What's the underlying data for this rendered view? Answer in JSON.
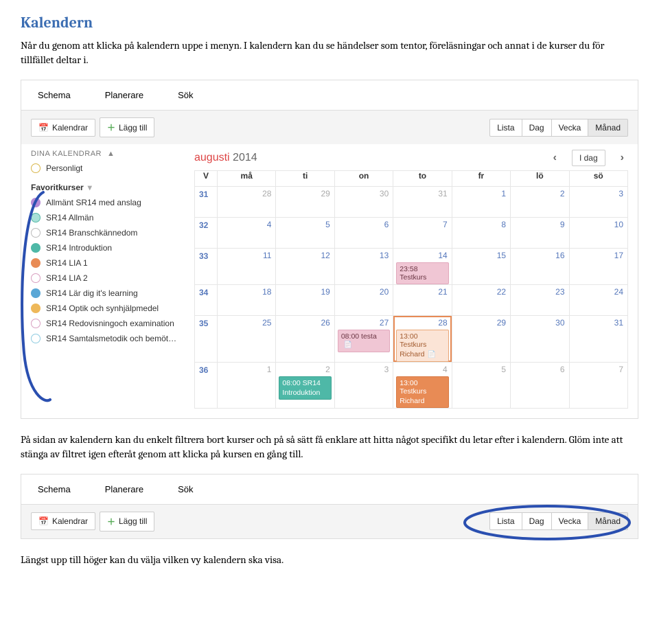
{
  "doc": {
    "heading": "Kalendern",
    "para1": "Når du genom att klicka på kalendern uppe i menyn. I kalendern kan du se händelser som tentor, föreläsningar och annat i de kurser du för tillfället deltar i.",
    "para2": "På sidan av kalendern kan du enkelt filtrera bort kurser och på så sätt få enklare att hitta något specifikt du letar efter i kalendern. Glöm inte att stänga av filtret igen efteråt genom att klicka på kursen en gång till.",
    "para3": "Längst upp till höger kan du välja vilken vy kalendern ska visa."
  },
  "tabs": {
    "schema": "Schema",
    "planerare": "Planerare",
    "sok": "Sök"
  },
  "toolbar": {
    "kalendrar": "Kalendrar",
    "laggtill": "Lägg till"
  },
  "views": {
    "lista": "Lista",
    "dag": "Dag",
    "vecka": "Vecka",
    "manad": "Månad"
  },
  "sidebar": {
    "label": "DINA KALENDRAR",
    "personal": "Personligt",
    "fav_title": "Favoritkurser",
    "items": [
      {
        "label": "Allmänt SR14 med anslag",
        "color": "#b58bd6"
      },
      {
        "label": "SR14 Allmän",
        "color": "#a8e1d8",
        "border": "#56b8a7"
      },
      {
        "label": "SR14 Branschkännedom",
        "color": "#ffffff",
        "border": "#bbb"
      },
      {
        "label": "SR14 Introduktion",
        "color": "#4eb8a7"
      },
      {
        "label": "SR14 LIA 1",
        "color": "#e88b55"
      },
      {
        "label": "SR14 LIA 2",
        "color": "#ffffff",
        "border": "#d89fc0"
      },
      {
        "label": "SR14 Lär dig it's learning",
        "color": "#5aa7d6"
      },
      {
        "label": "SR14 Optik och synhjälpmedel",
        "color": "#eeb85a"
      },
      {
        "label": "SR14 Redovisningoch examination",
        "color": "#ffffff",
        "border": "#d89fc0"
      },
      {
        "label": "SR14 Samtalsmetodik och bemöt…",
        "color": "#ffffff",
        "border": "#8fcbe0"
      }
    ]
  },
  "month": {
    "name": "augusti",
    "year": "2014",
    "today": "I dag"
  },
  "weekdays": [
    "V",
    "må",
    "ti",
    "on",
    "to",
    "fr",
    "lö",
    "sö"
  ],
  "weeks": [
    {
      "num": "31",
      "days": [
        "28",
        "29",
        "30",
        "31",
        "1",
        "2",
        "3"
      ],
      "muted": [
        0,
        1,
        2,
        3
      ]
    },
    {
      "num": "32",
      "days": [
        "4",
        "5",
        "6",
        "7",
        "8",
        "9",
        "10"
      ]
    },
    {
      "num": "33",
      "days": [
        "11",
        "12",
        "13",
        "14",
        "15",
        "16",
        "17"
      ]
    },
    {
      "num": "34",
      "days": [
        "18",
        "19",
        "20",
        "21",
        "22",
        "23",
        "24"
      ]
    },
    {
      "num": "35",
      "days": [
        "25",
        "26",
        "27",
        "28",
        "29",
        "30",
        "31"
      ]
    },
    {
      "num": "36",
      "days": [
        "1",
        "2",
        "3",
        "4",
        "5",
        "6",
        "7"
      ],
      "muted": [
        0,
        1,
        2,
        3,
        4,
        5,
        6
      ]
    }
  ],
  "events": {
    "w33_to": "23:58 Testkurs",
    "w35_on": "08:00 testa",
    "w35_to_a": "13:00 Testkurs",
    "w35_to_b": "Richard",
    "w36_ti_a": "08:00 SR14",
    "w36_ti_b": "Introduktion",
    "w36_to_a": "13:00 Testkurs",
    "w36_to_b": "Richard"
  }
}
